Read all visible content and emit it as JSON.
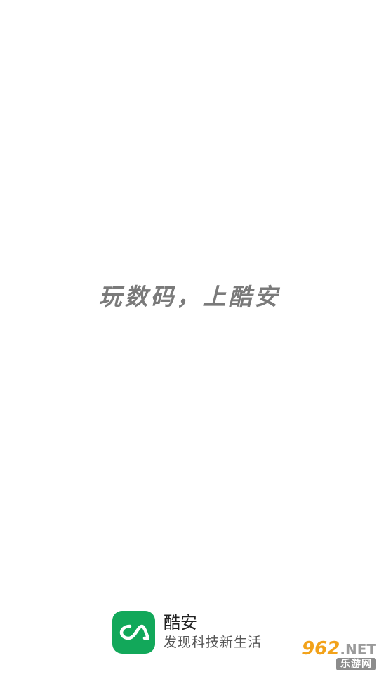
{
  "splash": {
    "slogan": "玩数码，上酷安"
  },
  "brand": {
    "app_name": "酷安",
    "tagline": "发现科技新生活",
    "icon": "coolapk-logo-icon",
    "icon_color": "#12a85a"
  },
  "watermark": {
    "number": "962",
    "domain": ".NET",
    "site_name": "乐游网",
    "accent_color": "#f2a21a"
  }
}
